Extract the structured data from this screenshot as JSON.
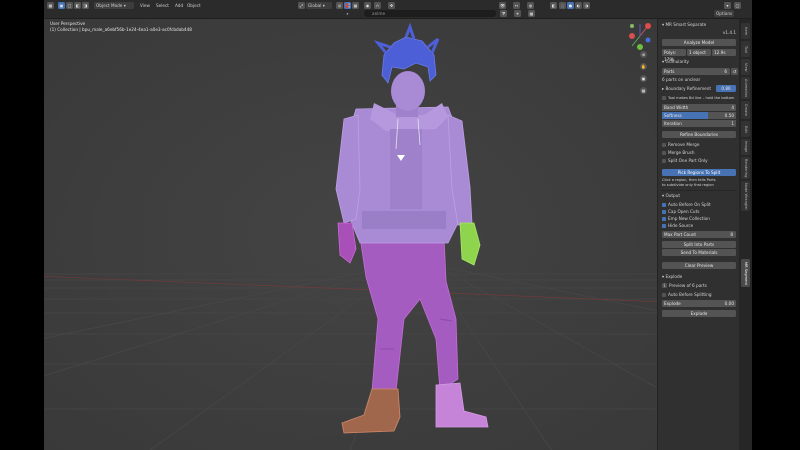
{
  "header": {
    "mode": "Object Mode",
    "menus": [
      "View",
      "Select",
      "Add",
      "Object"
    ],
    "orientation": "Global",
    "search_text": "anime",
    "options": "Options"
  },
  "viewport": {
    "perspective": "User Perspective",
    "collection": "(1) Collection | bpu_male_a6ebf56b-1e24-4ea1-a0e3-ac0fcbdab448"
  },
  "panel": {
    "title": "MR Smart Separate",
    "version": "v1.4.1",
    "analyze": "Analyze Model",
    "stats": [
      "Polys: 179k",
      "1 object",
      "12.9s"
    ],
    "granularity": "Granularity",
    "parts_label": "Parts",
    "parts_value": "6",
    "parts_summary": "6 parts on unclear",
    "boundary": "Boundary Refinement",
    "boundary_value": "0.86",
    "tool_hint": "Tool makes Bd line – hold the bottom",
    "band_width_label": "Band Width",
    "band_width_value": "4",
    "softness_label": "Softness",
    "softness_value": "0.50",
    "softness_fill": 0.62,
    "iteration_label": "Iteration",
    "iteration_value": "1",
    "refine": "Refine Boundaries",
    "remove_merge": "Remove Merge",
    "merge_brush": "Merge Brush",
    "split_one": "Split One Part Only",
    "pick_region": "Pick Regions To Split",
    "pick_hint_1": "Click a region, then tells Parts",
    "pick_hint_2": "to subdivide only that region",
    "output": "Output",
    "auto_before": "Auto Before On Split",
    "cap_open": "Cap Open Cuts",
    "new_collection": "Emp New Collection",
    "hide_source": "Hide Source",
    "max_part": "Max Part Count",
    "max_part_value": "8",
    "split_parts": "Split Into Parts",
    "send_to_materials": "Send To Materials",
    "clear_preview": "Clear Preview",
    "explode": "Explode",
    "preview_parts": "Preview of 6 parts",
    "auto_before_splitting": "Auto Before Splitting",
    "explode_label": "Explode",
    "explode_value": "0.00",
    "explode_btn": "Explode"
  },
  "tabs": [
    "Item",
    "Tool",
    "View",
    "Animation",
    "Create",
    "Edit",
    "Image",
    "Rendering",
    "Node Wrangler",
    "MR Segment"
  ],
  "colors": {
    "accent": "#4772b3",
    "hair": "#4d5fd6",
    "clothes": "#a98ad4",
    "pants": "#a55cc0",
    "left_glove": "#a84fb8",
    "right_glove": "#8fd44d",
    "shoe": "#a0674c"
  }
}
